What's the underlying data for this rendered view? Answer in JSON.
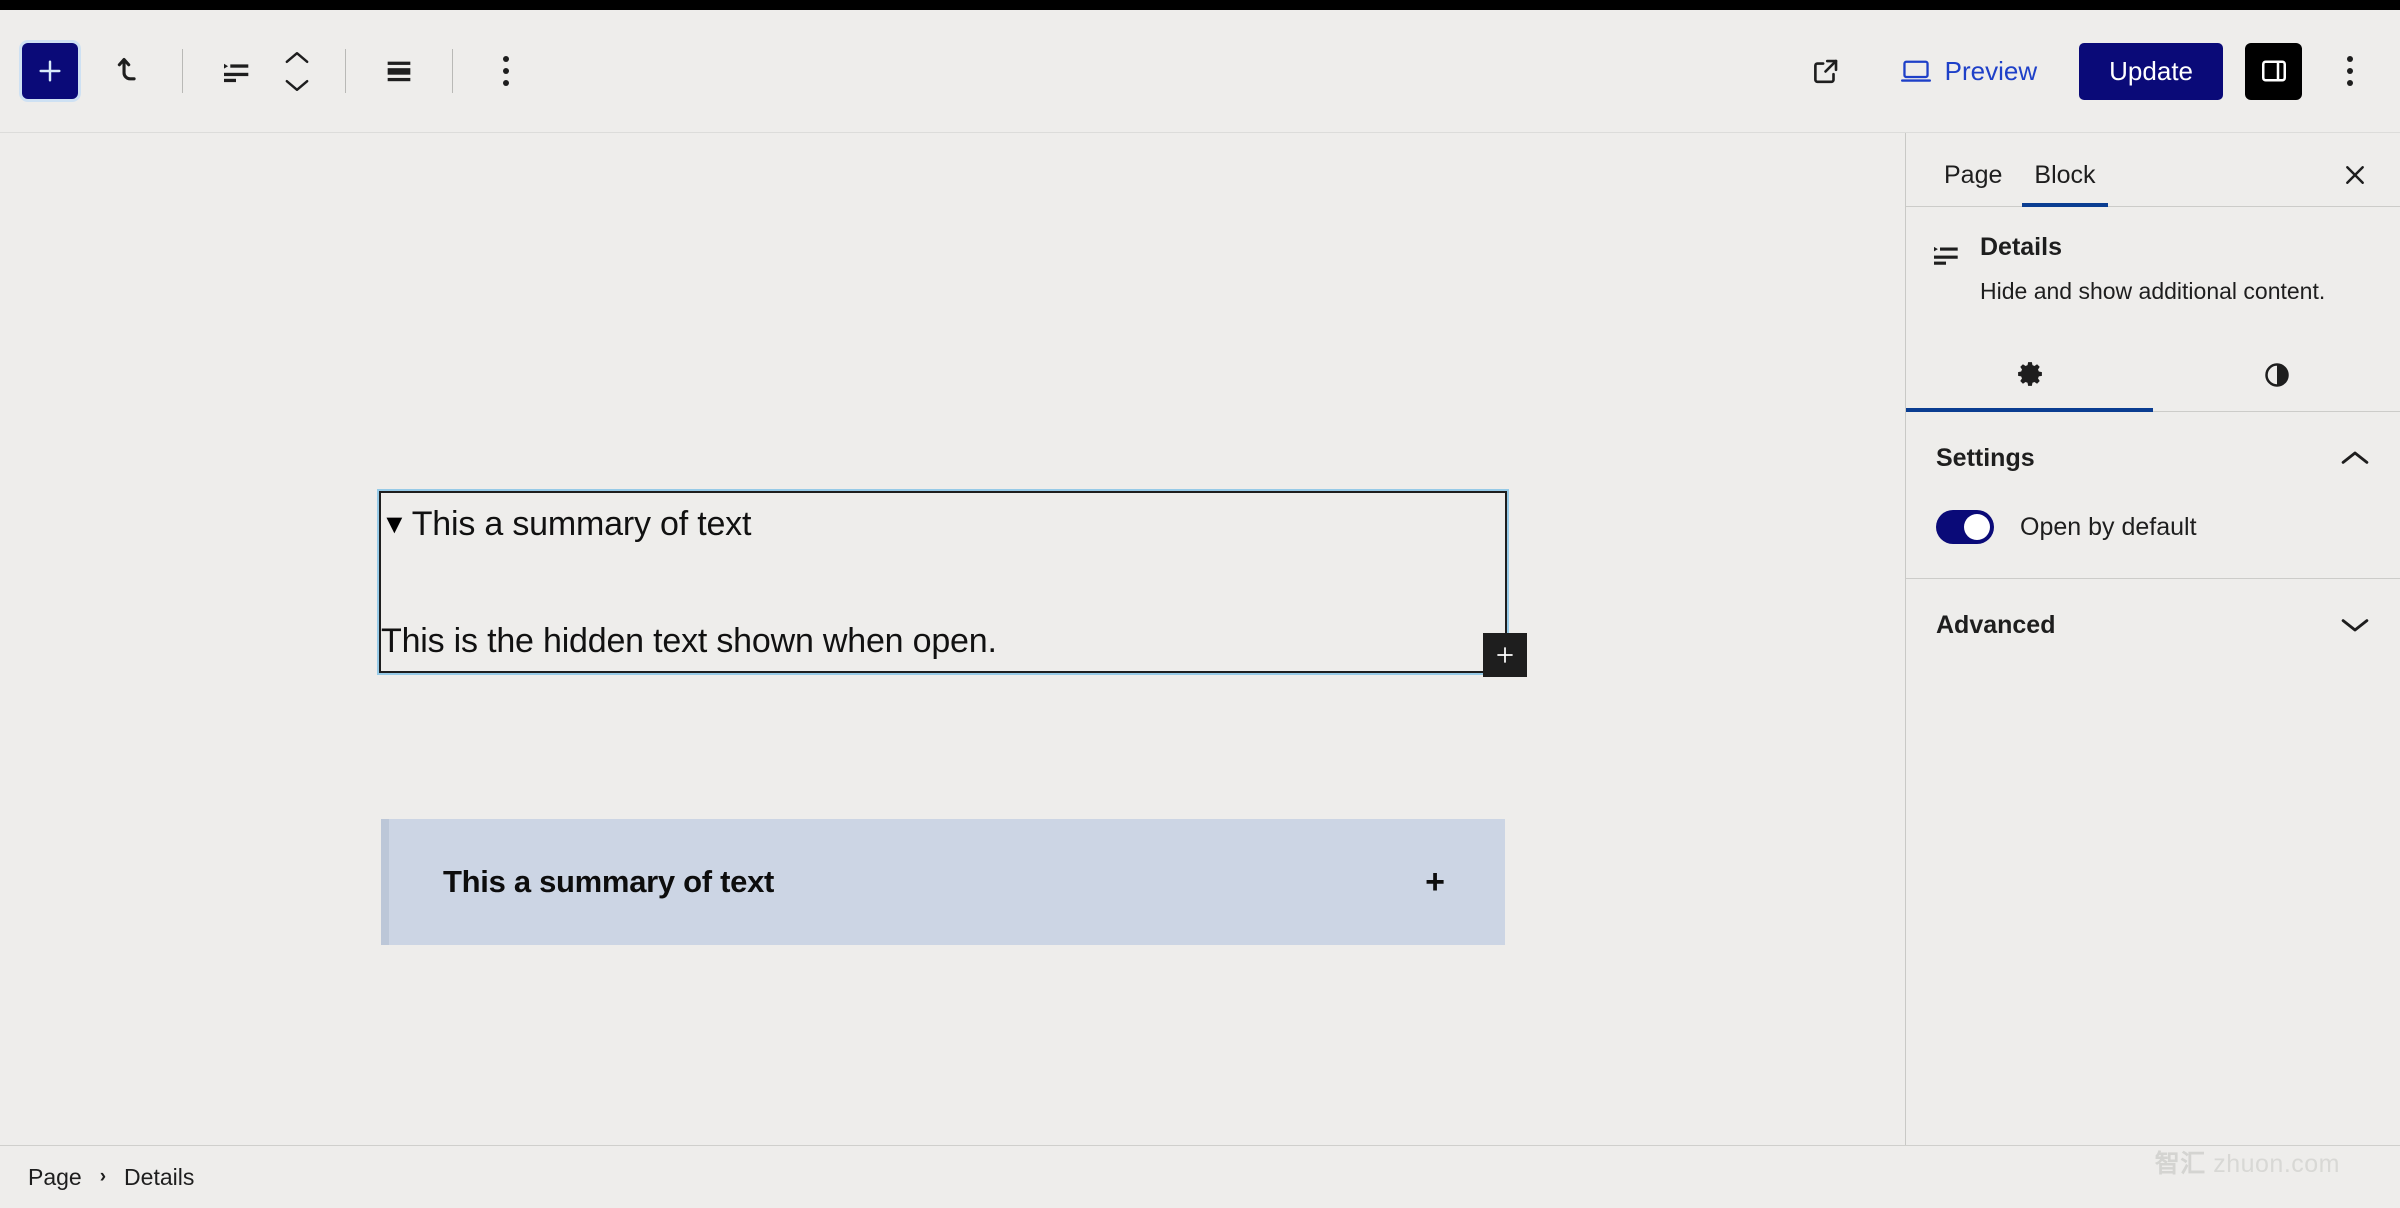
{
  "toolbar": {
    "add_block_label": "+",
    "add_block_icon": "plus-icon",
    "undo_icon": "undo-arrow-icon",
    "block_type_icon": "details-block-icon",
    "mover_icon": "move-up-down-icon",
    "align_icon": "align-icon",
    "options_icon": "three-dots-vertical-icon",
    "view_link_icon": "external-link-icon",
    "preview_label": "Preview",
    "preview_icon": "desktop-icon",
    "update_label": "Update",
    "sidebar_toggle_icon": "sidebar-panel-icon",
    "more_options_icon": "three-dots-vertical-icon"
  },
  "canvas": {
    "details_block": {
      "marker": "▼",
      "summary": "This a summary of text",
      "content": "This is the hidden text shown when open.",
      "appender_label": "+",
      "appender_icon": "plus-icon"
    },
    "blue_block": {
      "summary": "This a summary of text",
      "toggle_label": "+",
      "toggle_icon": "plus-icon",
      "background_color": "#ccd5e4"
    }
  },
  "sidebar": {
    "tabs": [
      {
        "label": "Page",
        "active": false
      },
      {
        "label": "Block",
        "active": true
      }
    ],
    "close_icon": "close-icon",
    "block_card": {
      "icon": "details-block-icon",
      "title": "Details",
      "description": "Hide and show additional content."
    },
    "icon_tabs": [
      {
        "icon": "gear-icon",
        "name": "settings",
        "active": true
      },
      {
        "icon": "contrast-half-circle-icon",
        "name": "styles",
        "active": false
      }
    ],
    "sections": [
      {
        "title": "Settings",
        "expanded": true,
        "chevron_icon": "chevron-up-icon"
      },
      {
        "title": "Advanced",
        "expanded": false,
        "chevron_icon": "chevron-down-icon"
      }
    ],
    "settings": {
      "open_by_default_label": "Open by default",
      "open_by_default_on": true
    }
  },
  "footer": {
    "breadcrumb": [
      "Page",
      "Details"
    ],
    "breadcrumb_separator": "›"
  },
  "watermark": {
    "cjk": "智汇",
    "latin": "zhuon.com"
  },
  "colors": {
    "accent_navy": "#0a0a78",
    "link_blue": "#1e40c8",
    "tab_underline": "#0a3d91",
    "canvas_bg": "#eeedeb",
    "blue_block_bg": "#ccd5e4"
  }
}
